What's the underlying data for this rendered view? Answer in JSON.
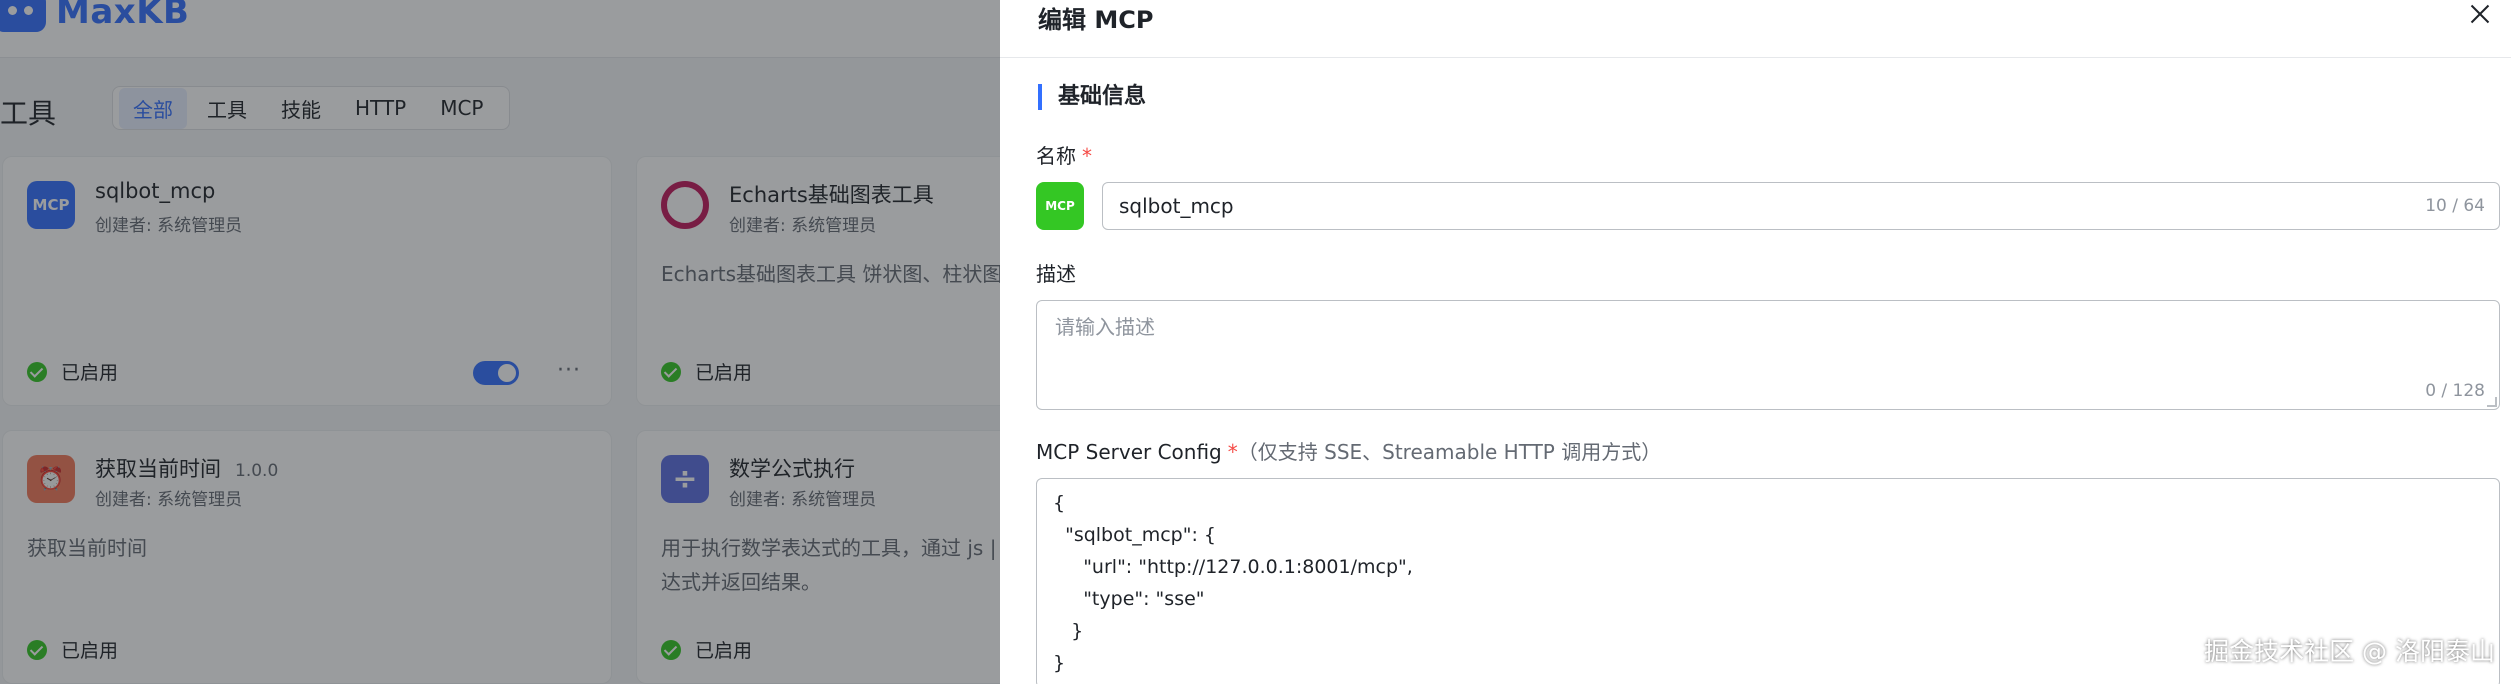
{
  "app": {
    "logo_text": "MaxKB",
    "page_title": "工具",
    "filter_tabs": [
      {
        "label": "全部",
        "active": true
      },
      {
        "label": "工具",
        "active": false
      },
      {
        "label": "技能",
        "active": false
      },
      {
        "label": "HTTP",
        "active": false
      },
      {
        "label": "MCP",
        "active": false
      }
    ],
    "cards": [
      {
        "title": "sqlbot_mcp",
        "version": "",
        "creator": "创建者: 系统管理员",
        "desc": "",
        "status": "已启用",
        "icon_label": "MCP",
        "icon_color": "#3370ff"
      },
      {
        "title": "Echarts基础图表工具",
        "version": "",
        "creator": "创建者: 系统管理员",
        "desc": "Echarts基础图表工具 饼状图、柱状图",
        "status": "已启用",
        "icon_label": "",
        "icon_color": "#c2185b"
      },
      {
        "title": "获取当前时间",
        "version": "1.0.0",
        "creator": "创建者: 系统管理员",
        "desc": "获取当前时间",
        "status": "已启用",
        "icon_label": "",
        "icon_color": "#f2795a"
      },
      {
        "title": "数学公式执行",
        "version": "",
        "creator": "创建者: 系统管理员",
        "desc": "用于执行数学表达式的工具，通过 js |\n达式并返回结果。",
        "status": "已启用",
        "icon_label": "÷",
        "icon_color": "#5b6ee1"
      }
    ]
  },
  "drawer": {
    "title": "编辑 MCP",
    "section_title": "基础信息",
    "name_label": "名称",
    "name_avatar": "MCP",
    "name_value": "sqlbot_mcp",
    "name_counter": "10 / 64",
    "desc_label": "描述",
    "desc_placeholder": "请输入描述",
    "desc_counter": "0 / 128",
    "config_label": "MCP Server Config",
    "config_hint": "（仅支持 SSE、Streamable HTTP 调用方式）",
    "config_value": "{\n  \"sqlbot_mcp\": {\n     \"url\": \"http://127.0.0.1:8001/mcp\",\n     \"type\": \"sse\"\n   }\n}",
    "required_mark": "*"
  },
  "watermark": "掘金技术社区 @ 洛阳泰山",
  "colors": {
    "primary": "#3370ff",
    "success": "#34c724",
    "required": "#f54a45"
  }
}
